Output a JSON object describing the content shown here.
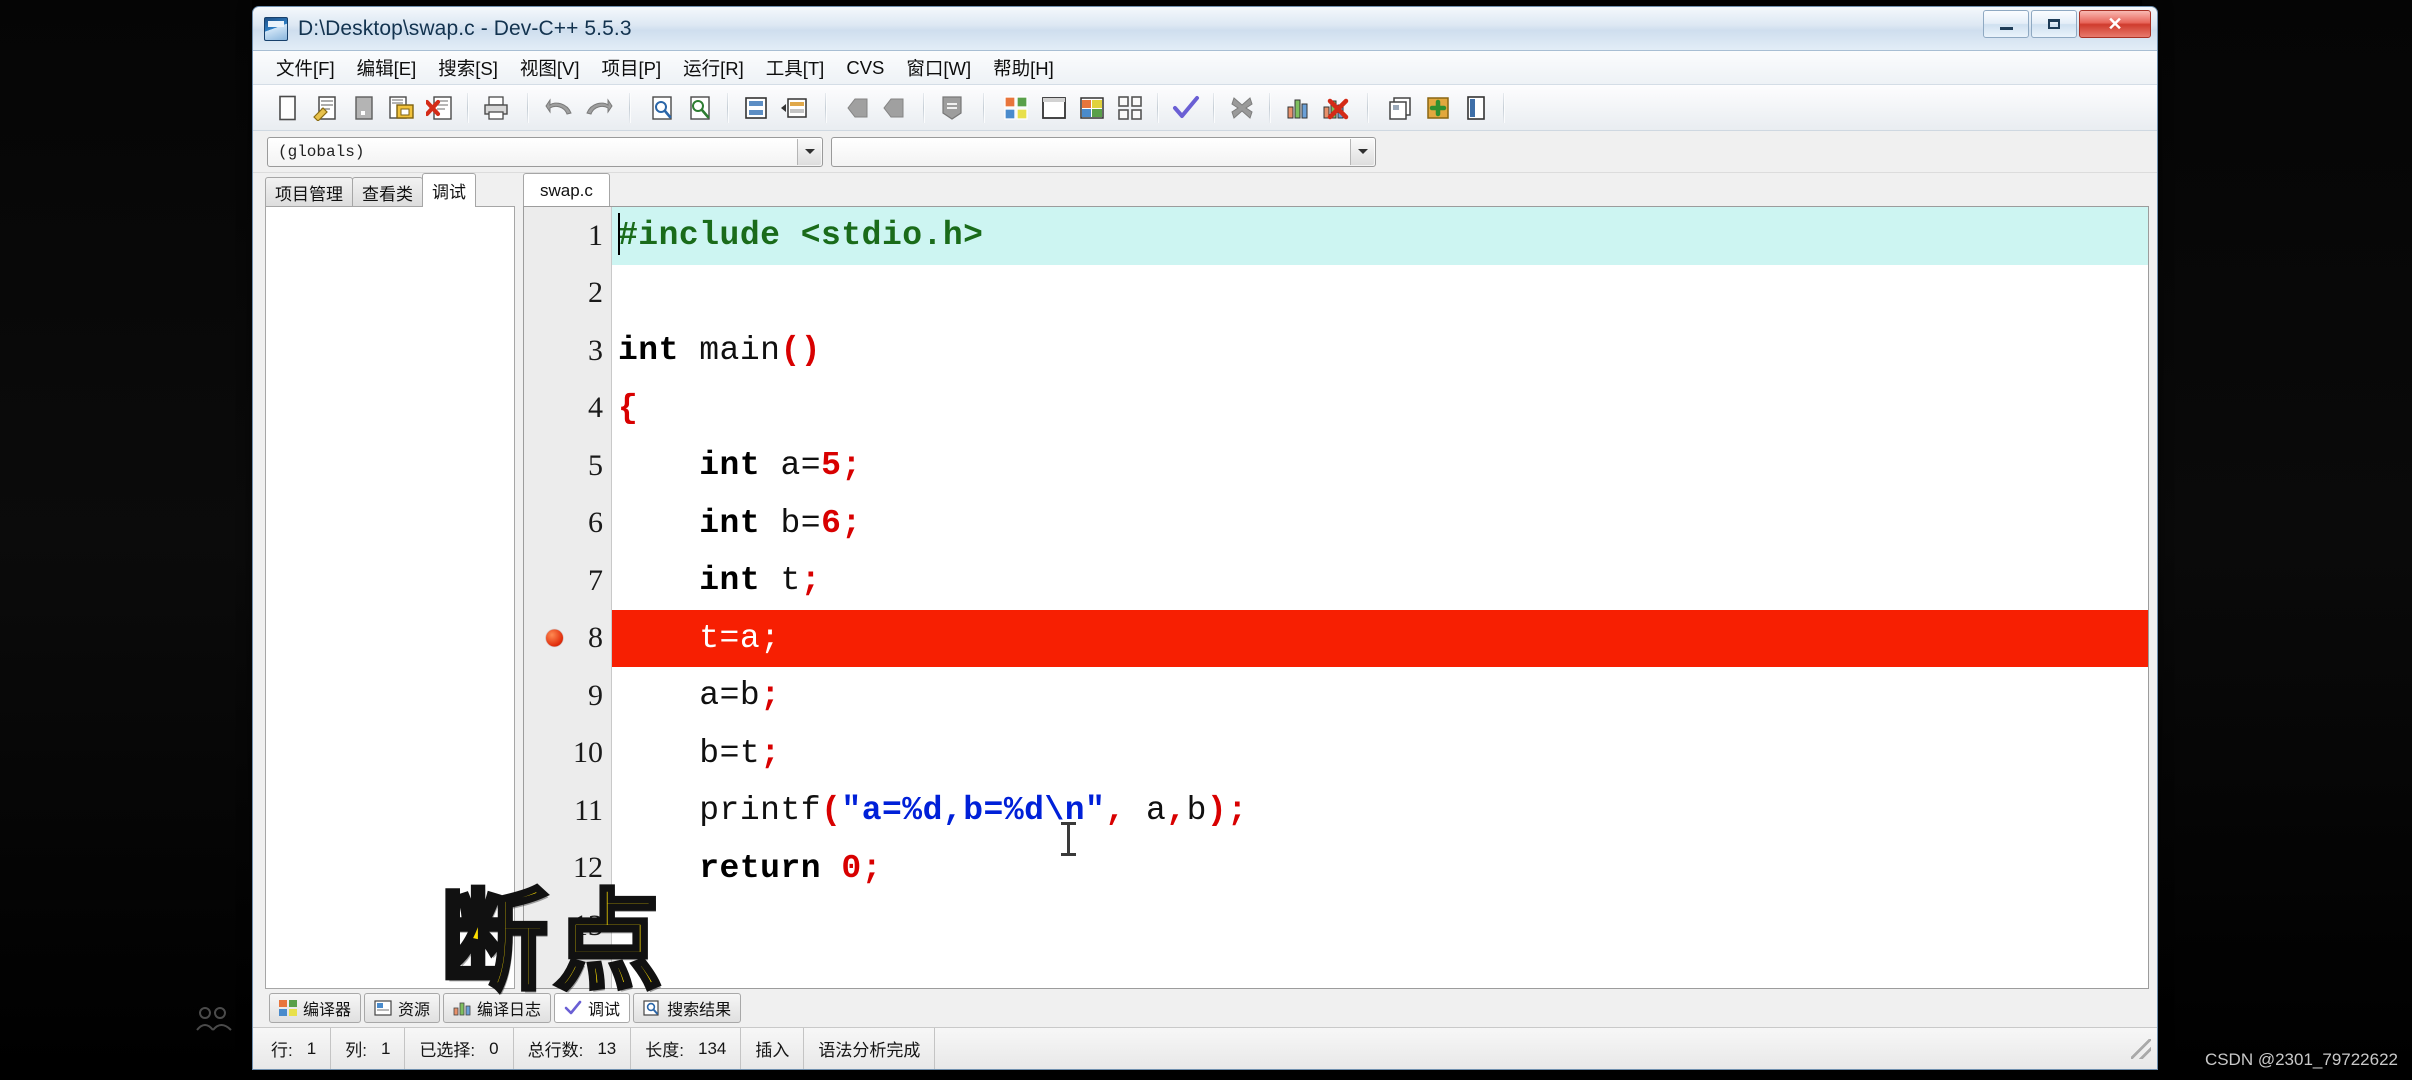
{
  "window": {
    "title": "D:\\Desktop\\swap.c - Dev-C++ 5.5.3",
    "app_icon": "dev-cpp-icon",
    "minimize_label": "",
    "maximize_label": "",
    "close_label": "✕"
  },
  "menubar": {
    "items": [
      {
        "name": "menu-file",
        "label": "文件[F]"
      },
      {
        "name": "menu-edit",
        "label": "编辑[E]"
      },
      {
        "name": "menu-search",
        "label": "搜索[S]"
      },
      {
        "name": "menu-view",
        "label": "视图[V]"
      },
      {
        "name": "menu-project",
        "label": "项目[P]"
      },
      {
        "name": "menu-run",
        "label": "运行[R]"
      },
      {
        "name": "menu-tools",
        "label": "工具[T]"
      },
      {
        "name": "menu-cvs",
        "label": "CVS"
      },
      {
        "name": "menu-window",
        "label": "窗口[W]"
      },
      {
        "name": "menu-help",
        "label": "帮助[H]"
      }
    ]
  },
  "toolbar": {
    "icons": [
      "new-file-icon",
      "open-file-icon",
      "save-icon",
      "save-all-icon",
      "close-file-icon",
      "print-icon",
      "undo-icon",
      "redo-icon",
      "find-icon",
      "replace-icon",
      "goto-line-icon",
      "toggle-panel-icon",
      "prev-icon",
      "next-icon",
      "bookmark-icon",
      "compile-icon",
      "run-icon",
      "compile-run-icon",
      "rebuild-icon",
      "syntax-check-icon",
      "stop-icon",
      "profile-icon",
      "delete-profile-icon",
      "copy-window-icon",
      "add-watch-icon",
      "toggle-bookmark-icon"
    ]
  },
  "combos": {
    "scope": {
      "value": "(globals)",
      "placeholder": "(globals)"
    },
    "symbol": {
      "value": "",
      "placeholder": ""
    }
  },
  "left_panel": {
    "tabs": [
      {
        "name": "tab-project-manager",
        "label": "项目管理",
        "active": false
      },
      {
        "name": "tab-class-browser",
        "label": "查看类",
        "active": false
      },
      {
        "name": "tab-debug",
        "label": "调试",
        "active": true
      }
    ]
  },
  "editor": {
    "tabs": [
      {
        "name": "tab-swap-c",
        "label": "swap.c",
        "active": true
      }
    ],
    "current_line": 1,
    "breakpoint_line": 8,
    "lines": [
      {
        "no": "1",
        "fold": false,
        "breakpoint": false,
        "current": true,
        "text": "#include <stdio.h>"
      },
      {
        "no": "2",
        "fold": false,
        "breakpoint": false,
        "current": false,
        "text": ""
      },
      {
        "no": "3",
        "fold": false,
        "breakpoint": false,
        "current": false,
        "text": "int main()"
      },
      {
        "no": "4",
        "fold": true,
        "breakpoint": false,
        "current": false,
        "text": "{"
      },
      {
        "no": "5",
        "fold": false,
        "breakpoint": false,
        "current": false,
        "text": "    int a=5;"
      },
      {
        "no": "6",
        "fold": false,
        "breakpoint": false,
        "current": false,
        "text": "    int b=6;"
      },
      {
        "no": "7",
        "fold": false,
        "breakpoint": false,
        "current": false,
        "text": "    int t;"
      },
      {
        "no": "8",
        "fold": false,
        "breakpoint": true,
        "current": false,
        "text": "    t=a;"
      },
      {
        "no": "9",
        "fold": false,
        "breakpoint": false,
        "current": false,
        "text": "    a=b;"
      },
      {
        "no": "10",
        "fold": false,
        "breakpoint": false,
        "current": false,
        "text": "    b=t;"
      },
      {
        "no": "11",
        "fold": false,
        "breakpoint": false,
        "current": false,
        "text": "    printf(\"a=%d,b=%d\\n\", a,b);"
      },
      {
        "no": "12",
        "fold": false,
        "breakpoint": false,
        "current": false,
        "text": "    return 0;"
      },
      {
        "no": "13",
        "fold": false,
        "breakpoint": false,
        "current": false,
        "text": ""
      }
    ]
  },
  "annotation": {
    "text": "断点",
    "color": "#ffe000"
  },
  "bottom_tabs": [
    {
      "name": "bottom-tab-compiler",
      "label": "编译器",
      "icon": "compiler-icon",
      "active": false
    },
    {
      "name": "bottom-tab-resources",
      "label": "资源",
      "icon": "resource-icon",
      "active": false
    },
    {
      "name": "bottom-tab-compile-log",
      "label": "编译日志",
      "icon": "log-icon",
      "active": false
    },
    {
      "name": "bottom-tab-debug",
      "label": "调试",
      "icon": "check-icon",
      "active": true
    },
    {
      "name": "bottom-tab-search-result",
      "label": "搜索结果",
      "icon": "search-icon",
      "active": false
    }
  ],
  "statusbar": {
    "row_label": "行:",
    "row_value": "1",
    "col_label": "列:",
    "col_value": "1",
    "sel_label": "已选择:",
    "sel_value": "0",
    "total_label": "总行数:",
    "total_value": "13",
    "len_label": "长度:",
    "len_value": "134",
    "mode": "插入",
    "message": "语法分析完成"
  },
  "watermark": "CSDN @2301_79722622"
}
